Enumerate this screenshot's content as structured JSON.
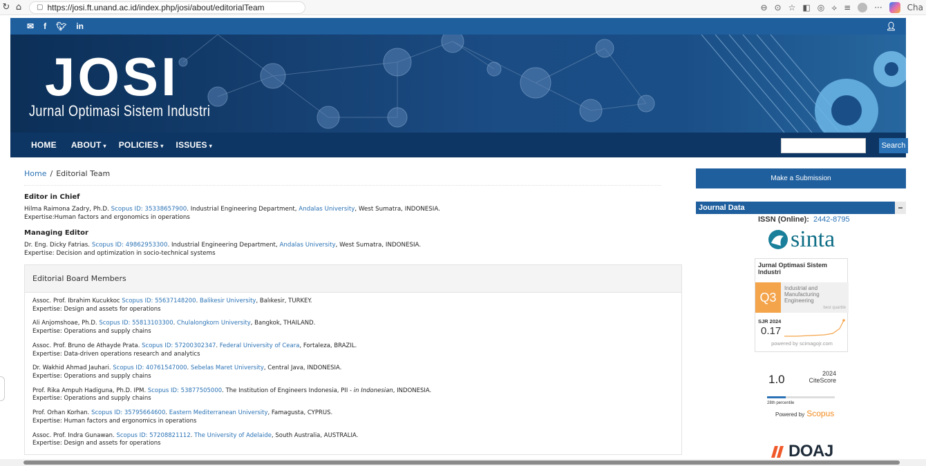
{
  "browser": {
    "url": "https://josi.ft.unand.ac.id/index.php/josi/about/editorialTeam",
    "right_label": "Cha"
  },
  "banner": {
    "logo": "JOSI",
    "subtitle": "Jurnal Optimasi Sistem Industri"
  },
  "nav": {
    "items": [
      {
        "label": "HOME",
        "caret": ""
      },
      {
        "label": "ABOUT",
        "caret": "▾"
      },
      {
        "label": "POLICIES",
        "caret": "▾"
      },
      {
        "label": "ISSUES",
        "caret": "▾"
      }
    ],
    "search_label": "Search",
    "search_value": ""
  },
  "breadcrumb": {
    "home": "Home",
    "sep": "/",
    "current": "Editorial Team"
  },
  "editor_in_chief": {
    "title": "Editor in Chief",
    "name": "Hilma Raimona Zadry, Ph.D. ",
    "scopus": "Scopus ID: 35338657900",
    "dept": ". Industrial Engineering Department, ",
    "univ": "Andalas University",
    "loc": ", West Sumatra, INDONESIA.",
    "expertise": "Expertise:Human factors and ergonomics in operations"
  },
  "managing_editor": {
    "title": "Managing Editor",
    "name": "Dr. Eng. Dicky Fatrias. ",
    "scopus": "Scopus ID: 49862953300",
    "dept": ". Industrial Engineering Department, ",
    "univ": "Andalas University",
    "loc": ", West Sumatra, INDONESIA.",
    "expertise": "Expertise: Decision and optimization in socio-technical systems"
  },
  "board": {
    "title": "Editorial Board Members",
    "members": [
      {
        "name": "Assoc. Prof. Ibrahim Kucukkoc ",
        "scopus": "Scopus ID: 55637148200",
        "mid": ". ",
        "univ": "Balikesir University",
        "loc": ", Balıkesir, TURKEY.",
        "italic": "",
        "tail": "",
        "expertise": "Expertise: Design and assets for operations"
      },
      {
        "name": "Ali Anjomshoae, Ph.D. ",
        "scopus": "Scopus ID: 55813103300",
        "mid": ". ",
        "univ": "Chulalongkorn University",
        "loc": ", Bangkok, THAILAND.",
        "italic": "",
        "tail": "",
        "expertise": "Expertise: Operations and supply chains"
      },
      {
        "name": "Assoc. Prof. Bruno de Athayde Prata. ",
        "scopus": "Scopus ID: 57200302347",
        "mid": ". ",
        "univ": "Federal University of Ceara",
        "loc": ", Fortaleza, BRAZIL.",
        "italic": "",
        "tail": "",
        "expertise": "Expertise: Data-driven operations research and analytics"
      },
      {
        "name": "Dr. Wakhid Ahmad Jauhari. ",
        "scopus": "Scopus ID: 40761547000",
        "mid": ". ",
        "univ": "Sebelas Maret University",
        "loc": ", Central Java, INDONESIA.",
        "italic": "",
        "tail": "",
        "expertise": "Expertise: Operations and supply chains"
      },
      {
        "name": "Prof. Rika Ampuh Hadiguna, Ph.D. IPM. ",
        "scopus": "Scopus ID: 53877505000",
        "mid": ". ",
        "univ": "",
        "loc": "The Institution of Engineers Indonesia, PII - ",
        "italic": "in Indonesian",
        "tail": ", INDONESIA.",
        "expertise": "Expertise: Operations and supply chains"
      },
      {
        "name": "Prof. Orhan Korhan. ",
        "scopus": "Scopus ID: 35795664600",
        "mid": ". ",
        "univ": "Eastern Mediterranean University",
        "loc": ", Famagusta, CYPRUS.",
        "italic": "",
        "tail": "",
        "expertise": "Expertise: Human factors and ergonomics in operations"
      },
      {
        "name": "Assoc. Prof. Indra Gunawan. ",
        "scopus": "Scopus ID: 57208821112",
        "mid": ". ",
        "univ": "The University of Adelaide",
        "loc": ", South Australia, AUSTRALIA.",
        "italic": "",
        "tail": "",
        "expertise": "Expertise: Design and assets for operations"
      }
    ]
  },
  "sidebar": {
    "submit": "Make a Submission",
    "journal_data": "Journal Data",
    "minus": "−",
    "issn_label": "ISSN (Online):",
    "issn": "2442-8795",
    "sinta": "sinta",
    "sjr": {
      "title": "Jurnal Optimasi Sistem Industri",
      "quartile": "Q3",
      "category": "Industrial and Manufacturing Engineering",
      "best": "best quartile",
      "label": "SJR 2024",
      "value": "0.17",
      "powered": "powered by scimagojr.com"
    },
    "citescore": {
      "value": "1.0",
      "year": "2024",
      "label": "CiteScore",
      "percentile_text": "28th percentile",
      "percentile": 28,
      "powered": "Powered by",
      "brand": "Scopus"
    },
    "doaj": "DOAJ"
  }
}
